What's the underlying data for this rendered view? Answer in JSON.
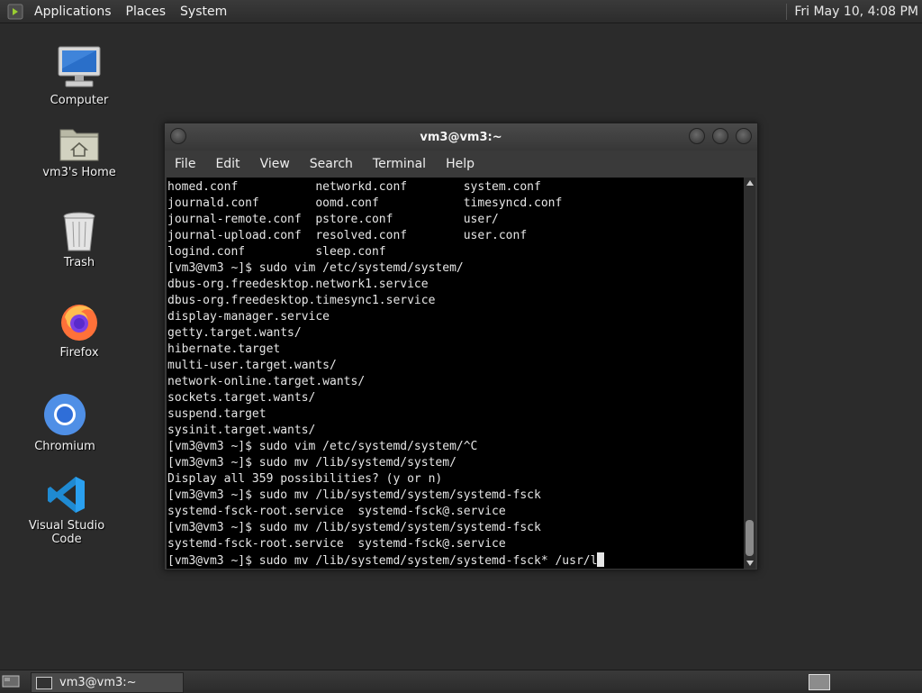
{
  "top_panel": {
    "menu": [
      "Applications",
      "Places",
      "System"
    ],
    "clock": "Fri May 10,  4:08 PM"
  },
  "desktop_icons": [
    {
      "label": "Computer",
      "icon": "computer-icon"
    },
    {
      "label": "vm3's Home",
      "icon": "home-folder-icon"
    },
    {
      "label": "Trash",
      "icon": "trash-icon"
    },
    {
      "label": "Firefox",
      "icon": "firefox-icon"
    },
    {
      "label": "Chromium",
      "icon": "chromium-icon"
    },
    {
      "label": "Visual Studio Code",
      "icon": "vscode-icon"
    }
  ],
  "terminal": {
    "title": "vm3@vm3:~",
    "menu": [
      "File",
      "Edit",
      "View",
      "Search",
      "Terminal",
      "Help"
    ],
    "lines": [
      "homed.conf           networkd.conf        system.conf",
      "journald.conf        oomd.conf            timesyncd.conf",
      "journal-remote.conf  pstore.conf          user/",
      "journal-upload.conf  resolved.conf        user.conf",
      "logind.conf          sleep.conf",
      "[vm3@vm3 ~]$ sudo vim /etc/systemd/system/",
      "dbus-org.freedesktop.network1.service",
      "dbus-org.freedesktop.timesync1.service",
      "display-manager.service",
      "getty.target.wants/",
      "hibernate.target",
      "multi-user.target.wants/",
      "network-online.target.wants/",
      "sockets.target.wants/",
      "suspend.target",
      "sysinit.target.wants/",
      "[vm3@vm3 ~]$ sudo vim /etc/systemd/system/^C",
      "[vm3@vm3 ~]$ sudo mv /lib/systemd/system/",
      "Display all 359 possibilities? (y or n)",
      "[vm3@vm3 ~]$ sudo mv /lib/systemd/system/systemd-fsck",
      "systemd-fsck-root.service  systemd-fsck@.service",
      "[vm3@vm3 ~]$ sudo mv /lib/systemd/system/systemd-fsck",
      "systemd-fsck-root.service  systemd-fsck@.service"
    ],
    "current_command": "[vm3@vm3 ~]$ sudo mv /lib/systemd/system/systemd-fsck* /usr/l"
  },
  "taskbar": {
    "task_label": "vm3@vm3:~"
  },
  "colors": {
    "desktop": "#2b2b2b",
    "terminal_bg": "#000000",
    "terminal_fg": "#e6e6e6"
  }
}
